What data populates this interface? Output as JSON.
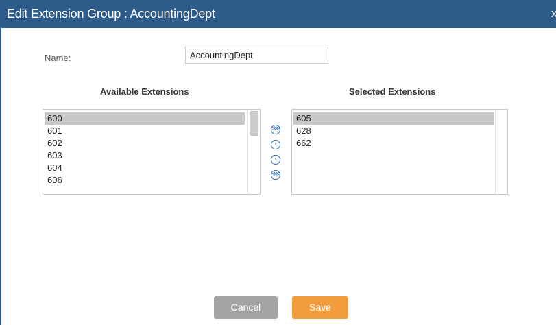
{
  "dialog": {
    "title": "Edit Extension Group : AccountingDept",
    "close_label": "x"
  },
  "form": {
    "name_label": "Name:",
    "name_value": "AccountingDept"
  },
  "available": {
    "title": "Available Extensions",
    "items": [
      "600",
      "601",
      "602",
      "603",
      "604",
      "606"
    ],
    "selected_item": "600"
  },
  "selected": {
    "title": "Selected Extensions",
    "items": [
      "605",
      "628",
      "662"
    ],
    "selected_item": "605"
  },
  "transfer_buttons": [
    {
      "name": "move-all-right-icon",
      "glyph": "⋙"
    },
    {
      "name": "move-right-icon",
      "glyph": "›"
    },
    {
      "name": "move-left-icon",
      "glyph": "‹"
    },
    {
      "name": "move-all-left-icon",
      "glyph": "⋘"
    }
  ],
  "buttons": {
    "cancel": "Cancel",
    "save": "Save"
  },
  "colors": {
    "titlebar": "#2d5c8a",
    "save": "#f39c3c",
    "cancel": "#a4a4a4",
    "list_selection": "#c8c8c8"
  }
}
